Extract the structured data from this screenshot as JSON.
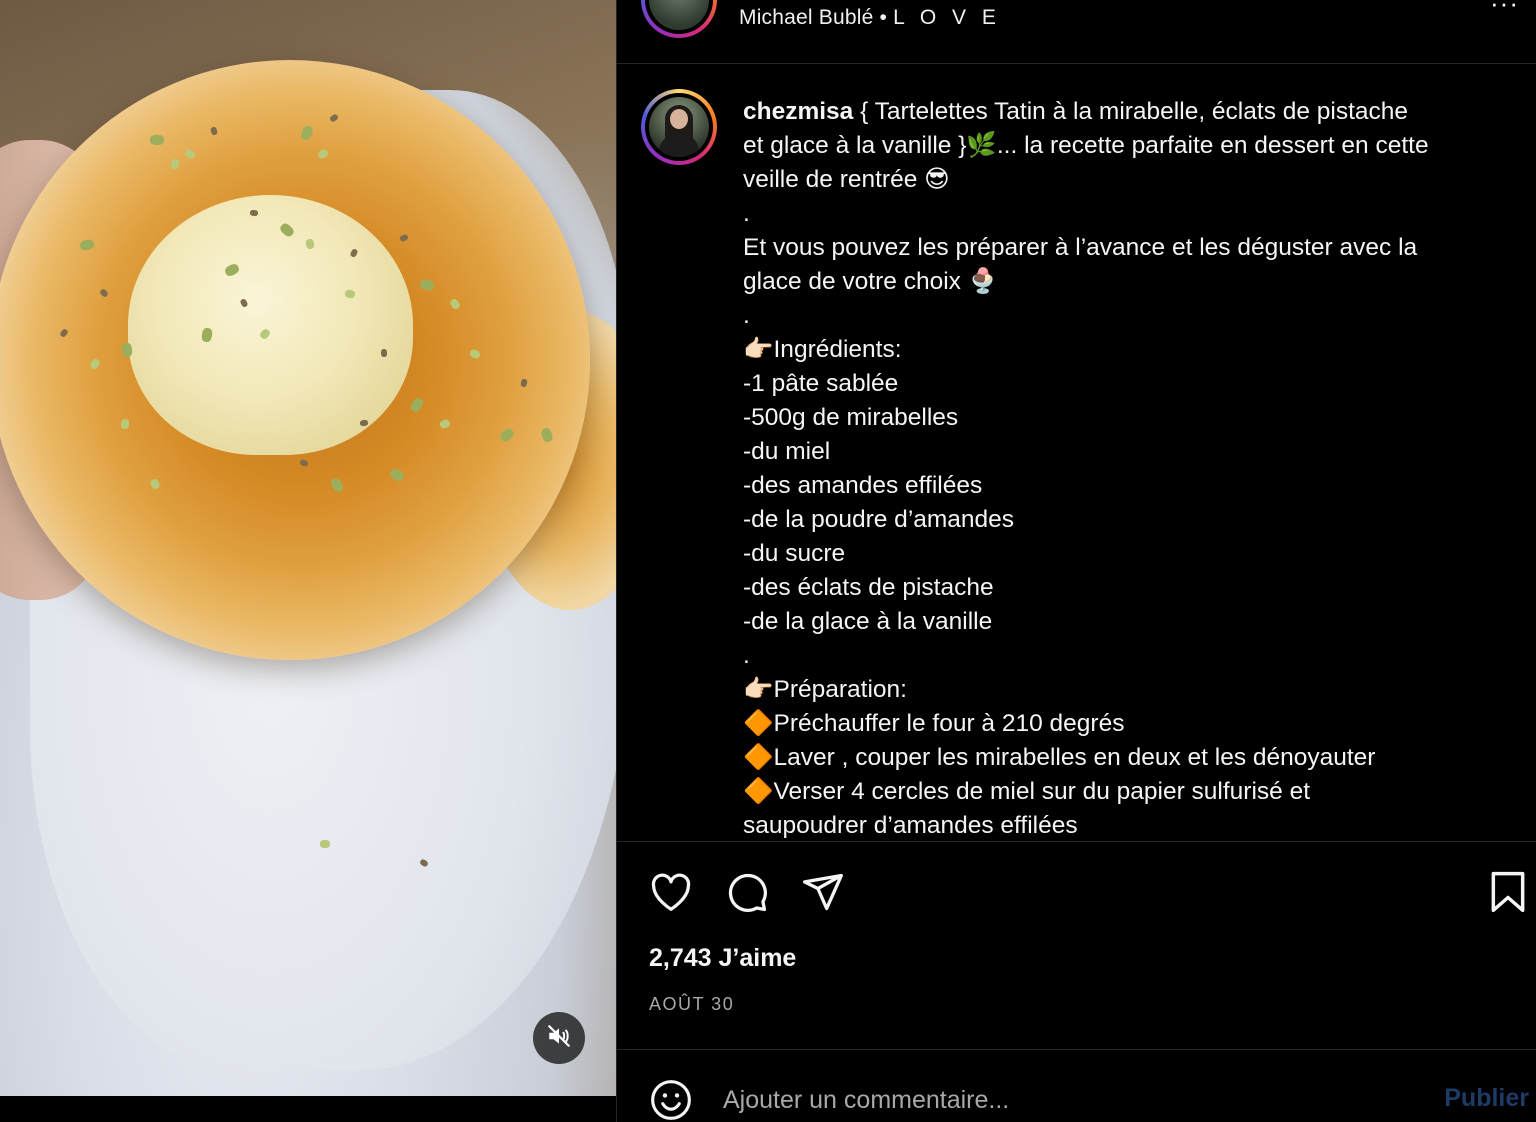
{
  "header": {
    "artist": "Michael Bublé",
    "separator": "•",
    "track": "L O V E",
    "more": "···"
  },
  "post": {
    "username": "chezmisa",
    "caption_lines": [
      " { Tartelettes Tatin à la mirabelle, éclats de pistache",
      "et glace à la vanille }🌿... la recette parfaite en dessert en cette",
      "veille de rentrée 😎",
      ".",
      "Et vous pouvez les préparer à l’avance et les déguster avec la",
      "glace de votre choix 🍨",
      ".",
      "👉🏻Ingrédients:",
      "-1 pâte sablée",
      "-500g de mirabelles",
      "-du miel",
      "-des amandes effilées",
      "-de la poudre d’amandes",
      "-du sucre",
      "-des éclats de pistache",
      "-de la glace à la vanille",
      ".",
      "👉🏻Préparation:",
      "🔶Préchauffer le four à 210 degrés",
      "🔶Laver , couper les mirabelles en deux et les dénoyauter",
      "🔶Verser 4 cercles de miel sur du papier sulfurisé et",
      "saupoudrer d’amandes effilées"
    ]
  },
  "actions": {
    "like_icon": "heart-icon",
    "comment_icon": "comment-icon",
    "share_icon": "send-icon",
    "save_icon": "bookmark-icon"
  },
  "likes": "2,743 J’aime",
  "date": "AOÛT 30",
  "comment": {
    "emoji_icon": "smiley-icon",
    "placeholder": "Ajouter un commentaire...",
    "publish_label": "Publier"
  },
  "media": {
    "mute_icon": "speaker-muted-icon"
  },
  "colors": {
    "background": "#000000",
    "divider": "#262626",
    "publish_disabled": "#1d3b66",
    "muted_text": "#a8a8a8"
  }
}
